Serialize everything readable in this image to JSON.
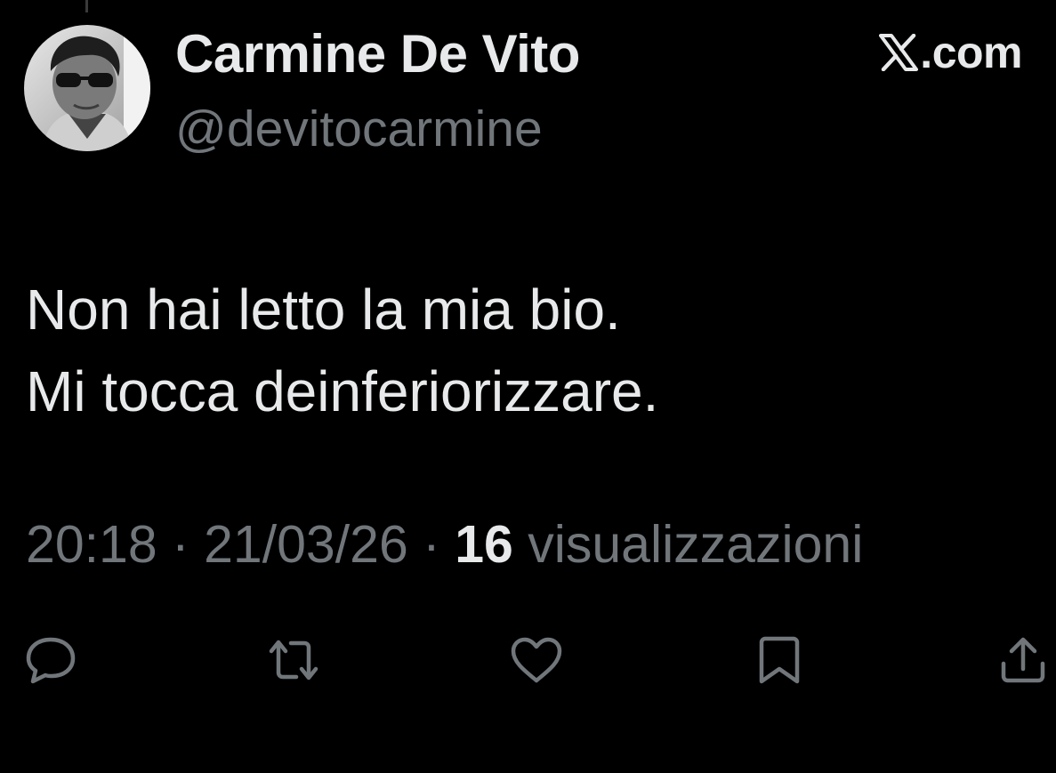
{
  "author": {
    "name": "Carmine De Vito",
    "handle": "@devitocarmine"
  },
  "source": {
    "domain": ".com",
    "logo_icon": "x-logo-icon"
  },
  "tweet": {
    "lines": [
      "Non hai letto la mia bio.",
      "Mi tocca deinferiorizzare."
    ]
  },
  "meta": {
    "time": "20:18",
    "separator1": " · ",
    "date": "21/03/26",
    "separator2": " · ",
    "views_count": "16",
    "views_label": " visualizzazioni"
  },
  "actions": [
    {
      "icon": "reply-icon"
    },
    {
      "icon": "repost-icon"
    },
    {
      "icon": "like-icon"
    },
    {
      "icon": "bookmark-icon"
    },
    {
      "icon": "share-icon"
    }
  ],
  "colors": {
    "background": "#000000",
    "primary_text": "#e7e9ea",
    "secondary_text": "#71767b",
    "icon": "#71767b"
  }
}
